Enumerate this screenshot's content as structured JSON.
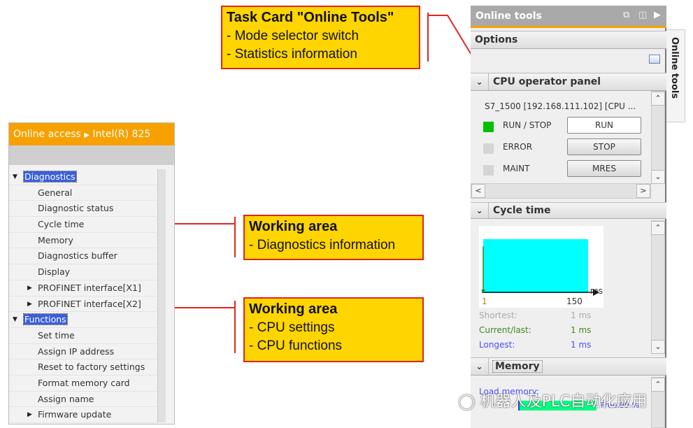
{
  "callouts": [
    {
      "title": "Task Card \"Online Tools\"",
      "lines": [
        "- Mode selector switch",
        "- Statistics information"
      ]
    },
    {
      "title": "Working area",
      "lines": [
        "- Diagnostics information"
      ]
    },
    {
      "title": "Working area",
      "lines": [
        "- CPU settings",
        "- CPU functions"
      ]
    }
  ],
  "left": {
    "breadcrumb": [
      "Online access",
      "Intel(R) 825"
    ],
    "tree": [
      {
        "label": "Diagnostics",
        "level": 0,
        "expanded": true,
        "selected": true
      },
      {
        "label": "General",
        "level": 1
      },
      {
        "label": "Diagnostic status",
        "level": 1
      },
      {
        "label": "Cycle time",
        "level": 1
      },
      {
        "label": "Memory",
        "level": 1
      },
      {
        "label": "Diagnostics buffer",
        "level": 1
      },
      {
        "label": "Display",
        "level": 1
      },
      {
        "label": "PROFINET interface[X1]",
        "level": 1,
        "expanded": false
      },
      {
        "label": "PROFINET interface[X2]",
        "level": 1,
        "expanded": false
      },
      {
        "label": "Functions",
        "level": 0,
        "expanded": true,
        "selected": true
      },
      {
        "label": "Set time",
        "level": 1
      },
      {
        "label": "Assign IP address",
        "level": 1
      },
      {
        "label": "Reset to factory settings",
        "level": 1
      },
      {
        "label": "Format memory card",
        "level": 1
      },
      {
        "label": "Assign name",
        "level": 1
      },
      {
        "label": "Firmware update",
        "level": 1,
        "expanded": false
      }
    ]
  },
  "right": {
    "title": "Online tools",
    "side_tab": "Online tools",
    "options": "Options",
    "cpu_panel": {
      "title": "CPU operator panel",
      "device": "S7_1500 [192.168.111.102] [CPU ...",
      "rows": [
        {
          "label": "RUN / STOP",
          "button": "RUN",
          "led": "#00c000"
        },
        {
          "label": "ERROR",
          "button": "STOP",
          "led": "#d5d5d5"
        },
        {
          "label": "MAINT",
          "button": "MRES",
          "led": "#d5d5d5"
        }
      ]
    },
    "cycle": {
      "title": "Cycle time",
      "axis_min": "1",
      "axis_max": "150",
      "unit": "ms",
      "shortest_label": "Shortest:",
      "shortest": "1 ms",
      "current_label": "Current/last:",
      "current": "1 ms",
      "longest_label": "Longest:",
      "longest": "1 ms"
    },
    "memory": {
      "title": "Memory",
      "load_label": "Load memory:",
      "free": "Free:99 %",
      "free_fraction": 0.99
    }
  },
  "watermark": "机器人及PLC自动化应用",
  "colors": {
    "orange": "#f7a100",
    "callout": "#ffd500",
    "red": "#e0251e",
    "cyan": "#00ffff"
  }
}
